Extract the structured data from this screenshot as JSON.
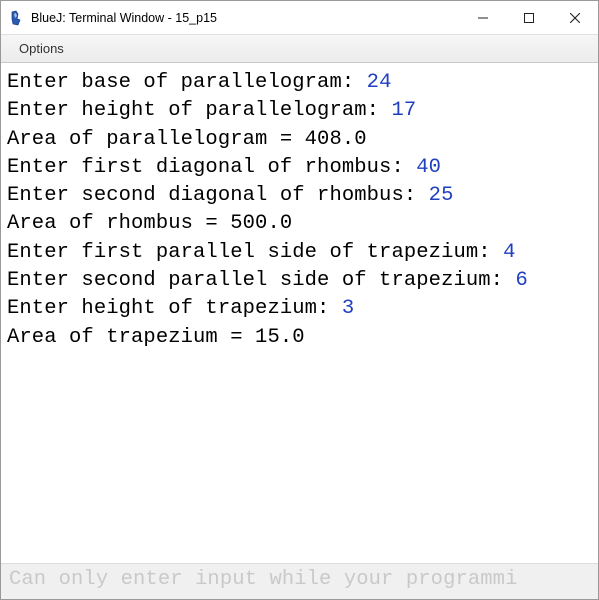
{
  "window": {
    "title": "BlueJ: Terminal Window - 15_p15",
    "buttons": {
      "min": "minimize",
      "max": "maximize",
      "close": "close"
    }
  },
  "menubar": {
    "options": "Options"
  },
  "terminal": {
    "lines": [
      {
        "prompt": "Enter base of parallelogram: ",
        "input": "24"
      },
      {
        "prompt": "Enter height of parallelogram: ",
        "input": "17"
      },
      {
        "prompt": "Area of parallelogram = 408.0",
        "input": ""
      },
      {
        "prompt": "Enter first diagonal of rhombus: ",
        "input": "40"
      },
      {
        "prompt": "Enter second diagonal of rhombus: ",
        "input": "25"
      },
      {
        "prompt": "Area of rhombus = 500.0",
        "input": ""
      },
      {
        "prompt": "Enter first parallel side of trapezium: ",
        "input": "4"
      },
      {
        "prompt": "Enter second parallel side of trapezium: ",
        "input": "6"
      },
      {
        "prompt": "Enter height of trapezium: ",
        "input": "3"
      },
      {
        "prompt": "Area of trapezium = 15.0",
        "input": ""
      }
    ]
  },
  "status": {
    "text": "Can only enter input while your programmi"
  }
}
